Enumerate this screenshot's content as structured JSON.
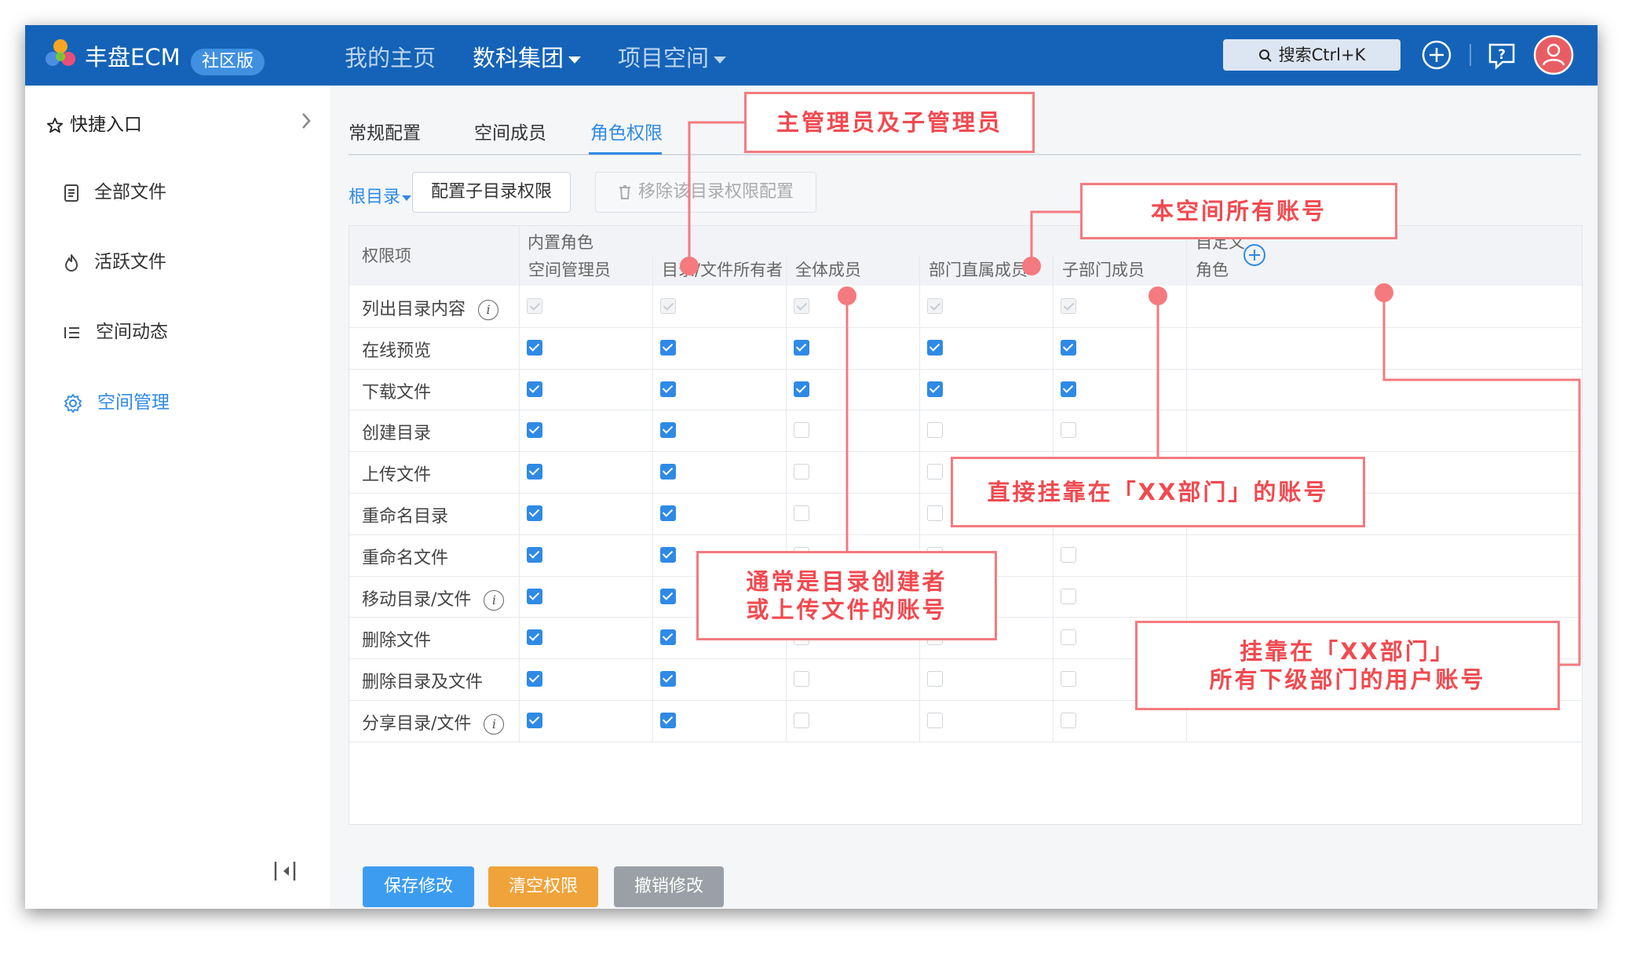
{
  "app": {
    "brand": "丰盘ECM",
    "edition": "社区版",
    "nav": [
      {
        "label": "我的主页",
        "active": false
      },
      {
        "label": "数科集团",
        "active": true,
        "dropdown": true
      },
      {
        "label": "项目空间",
        "active": false,
        "dropdown": true
      }
    ],
    "search_label": "搜索Ctrl+K",
    "icons": [
      "add-circle-icon",
      "help-icon",
      "user-avatar-icon"
    ],
    "colors": {
      "topbar": "#1463b8",
      "accent": "#2f8ae5",
      "callout": "#f47a7f"
    }
  },
  "sidebar": {
    "quick_entry": "快捷入口",
    "items": [
      {
        "label": "全部文件",
        "icon": "document-icon",
        "active": false
      },
      {
        "label": "活跃文件",
        "icon": "flame-icon",
        "active": false
      },
      {
        "label": "空间动态",
        "icon": "list-icon",
        "active": false
      },
      {
        "label": "空间管理",
        "icon": "gear-icon",
        "active": true
      }
    ]
  },
  "tabs": [
    {
      "label": "常规配置",
      "active": false
    },
    {
      "label": "空间成员",
      "active": false
    },
    {
      "label": "角色权限",
      "active": true
    }
  ],
  "toolbar": {
    "root_dir": "根目录",
    "config_sub": "配置子目录权限",
    "remove_config": "移除该目录权限配置"
  },
  "table": {
    "perm_header": "权限项",
    "builtin_group": "内置角色",
    "custom_header_line1": "自定义",
    "custom_header_line2": "角色",
    "roles": [
      "空间管理员",
      "目录/文件所有者",
      "全体成员",
      "部门直属成员",
      "子部门成员"
    ],
    "rows": [
      {
        "label": "列出目录内容",
        "info": true,
        "values": [
          "d",
          "d",
          "d",
          "d",
          "d"
        ]
      },
      {
        "label": "在线预览",
        "info": false,
        "values": [
          "on",
          "on",
          "on",
          "on",
          "on"
        ]
      },
      {
        "label": "下载文件",
        "info": false,
        "values": [
          "on",
          "on",
          "on",
          "on",
          "on"
        ]
      },
      {
        "label": "创建目录",
        "info": false,
        "values": [
          "on",
          "on",
          "off",
          "off",
          "off"
        ]
      },
      {
        "label": "上传文件",
        "info": false,
        "values": [
          "on",
          "on",
          "off",
          "off",
          "off"
        ]
      },
      {
        "label": "重命名目录",
        "info": false,
        "values": [
          "on",
          "on",
          "off",
          "off",
          "off"
        ]
      },
      {
        "label": "重命名文件",
        "info": false,
        "values": [
          "on",
          "on",
          "off",
          "off",
          "off"
        ]
      },
      {
        "label": "移动目录/文件",
        "info": true,
        "values": [
          "on",
          "on",
          "off",
          "off",
          "off"
        ]
      },
      {
        "label": "删除文件",
        "info": false,
        "values": [
          "on",
          "on",
          "off",
          "off",
          "off"
        ]
      },
      {
        "label": "删除目录及文件",
        "info": false,
        "values": [
          "on",
          "on",
          "off",
          "off",
          "off"
        ]
      },
      {
        "label": "分享目录/文件",
        "info": true,
        "values": [
          "on",
          "on",
          "off",
          "off",
          "off"
        ]
      }
    ]
  },
  "footer": {
    "save": "保存修改",
    "clear": "清空权限",
    "undo": "撤销修改"
  },
  "annotations": {
    "admins": "主管理员及子管理员",
    "all_accounts": "本空间所有账号",
    "direct_dept": "直接挂靠在「XX部门」的账号",
    "owner_line1": "通常是目录创建者",
    "owner_line2": "或上传文件的账号",
    "subdept_line1": "挂靠在「XX部门」",
    "subdept_line2": "所有下级部门的用户账号"
  }
}
